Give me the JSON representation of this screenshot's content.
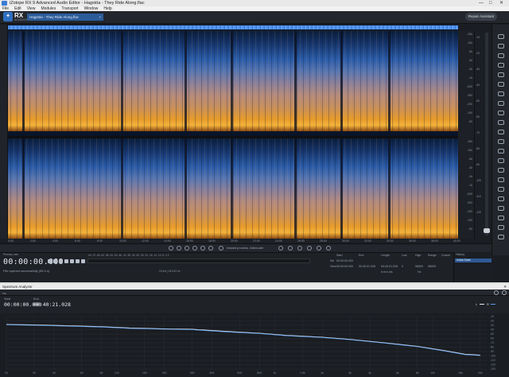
{
  "window": {
    "title": "iZotope RX 9 Advanced Audio Editor - Hagstöa - They Ride Along.flac",
    "controls": [
      "—",
      "□",
      "✕"
    ]
  },
  "menu": [
    "File",
    "Edit",
    "View",
    "Modules",
    "Transport",
    "Window",
    "Help"
  ],
  "toolbar": {
    "logo_text": "RX",
    "logo_sub": "ADVANCED",
    "file_tab": "Hagstöa - They Ride Along.flac",
    "file_tab_close": "×",
    "repair_assistant": "Repair Assistant"
  },
  "freq_scale": [
    "-20k",
    "-10k",
    "-5k",
    "-3k",
    "-2k",
    "-1k",
    "-500",
    "-300",
    "-200",
    "-100",
    "-50",
    "-20k",
    "-10k",
    "-5k",
    "-3k",
    "-2k",
    "-1k",
    "-500",
    "-300",
    "-200",
    "-100",
    "-50"
  ],
  "amp_scale": [
    "-10",
    "-20",
    "-30",
    "-40",
    "-50",
    "-60",
    "-70",
    "-80",
    "-90",
    "-100",
    "-110",
    "-120"
  ],
  "time_ruler": [
    "0:00",
    "2:00",
    "4:00",
    "6:00",
    "8:00",
    "10:00",
    "12:00",
    "14:00",
    "16:00",
    "18:00",
    "20:00",
    "22:00",
    "24:00",
    "26:00",
    "28:00",
    "30:00",
    "32:00",
    "34:00",
    "36:00",
    "38:00",
    "40:00"
  ],
  "tools": {
    "instant_process": "Instant process",
    "mode": "Attenuate"
  },
  "transport": {
    "label": "Primary rate",
    "timecode": "00:00:00.000",
    "status": "File opened successfully (55.0 s)",
    "bit_info": "24-bit | 44100 Hz",
    "meter_scale": "-Inf -70 -66 -62 -58 -54 -50 -46 -42 -38 -34 -30 -26 -22 -18 -14 -10 -6 -2 0"
  },
  "selection": {
    "headers": [
      "Start",
      "End",
      "Length",
      "Low",
      "High",
      "Range",
      "Cursor"
    ],
    "sel_label": "Sel",
    "view_label": "View",
    "sel": [
      "00:00:00.000",
      "",
      "",
      "",
      "",
      "",
      ""
    ],
    "view": [
      "00:00:00.000",
      "00:40:21.028",
      "00:40:21.028",
      "0",
      "96000",
      "96000",
      ""
    ],
    "sub": [
      "",
      "",
      "h:m:s.ms",
      "",
      "Hz",
      "",
      ""
    ]
  },
  "history": {
    "header": "History",
    "item": "Initial State"
  },
  "spectrum_analyzer": {
    "title": "Spectrum Analyzer",
    "close": "✕",
    "start_label": "Start",
    "start_value": "00:00:00.000",
    "end_label": "End",
    "end_value": "00:40:21.028",
    "legend": [
      "L",
      "R"
    ],
    "colors": {
      "L": "#e6e9ee",
      "R": "#5b9ef0"
    }
  },
  "chart_data": {
    "type": "line",
    "title": "",
    "xlabel": "",
    "ylabel": "",
    "x_scale": "log",
    "xlim": [
      20,
      22000
    ],
    "ylim": [
      -130,
      -10
    ],
    "grid": true,
    "legend": "top-right",
    "x_ticks": [
      "20",
      "30",
      "40",
      "60",
      "80",
      "100",
      "150",
      "200",
      "300",
      "400",
      "600",
      "800",
      "1k",
      "1.5k",
      "2k",
      "3k",
      "4k",
      "6k",
      "8k",
      "10k",
      "15k",
      "20k"
    ],
    "y_ticks": [
      "-10",
      "-20",
      "-30",
      "-40",
      "-50",
      "-60",
      "-70",
      "-80",
      "-90",
      "-100",
      "-110",
      "-120",
      "-130"
    ],
    "x": [
      20,
      30,
      50,
      80,
      120,
      200,
      300,
      500,
      800,
      1200,
      2000,
      3000,
      5000,
      8000,
      12000,
      16000,
      20000
    ],
    "series": [
      {
        "name": "L",
        "values": [
          -28,
          -29,
          -31,
          -33,
          -36,
          -38,
          -39,
          -44,
          -48,
          -53,
          -57,
          -62,
          -70,
          -78,
          -88,
          -96,
          -98
        ]
      },
      {
        "name": "R",
        "values": [
          -29,
          -30,
          -32,
          -34,
          -37,
          -39,
          -40,
          -45,
          -49,
          -54,
          -58,
          -63,
          -71,
          -79,
          -89,
          -97,
          -99
        ]
      }
    ]
  }
}
